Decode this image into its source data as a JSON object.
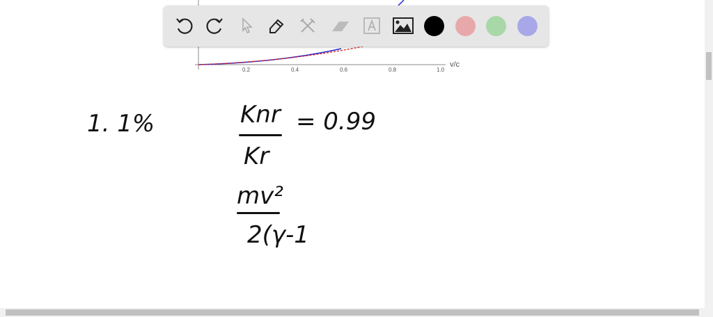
{
  "plot": {
    "xlabel": "v/c",
    "xticks": [
      "0.2",
      "0.4",
      "0.6",
      "0.8",
      "1.0"
    ]
  },
  "toolbar": {
    "tools": [
      "undo-icon",
      "redo-icon",
      "select-icon",
      "pen-icon",
      "tools-icon",
      "eraser-icon",
      "text-icon",
      "image-icon"
    ],
    "colors": [
      "#000000",
      "#e8a8aa",
      "#a8d8a8",
      "#a8a8e8"
    ]
  },
  "notes": {
    "line1": "1. 1%",
    "numerator": "Knr",
    "denominator": "Kr",
    "equals": "= 0.99",
    "num2": "mv²",
    "den2": "2(γ-1"
  }
}
